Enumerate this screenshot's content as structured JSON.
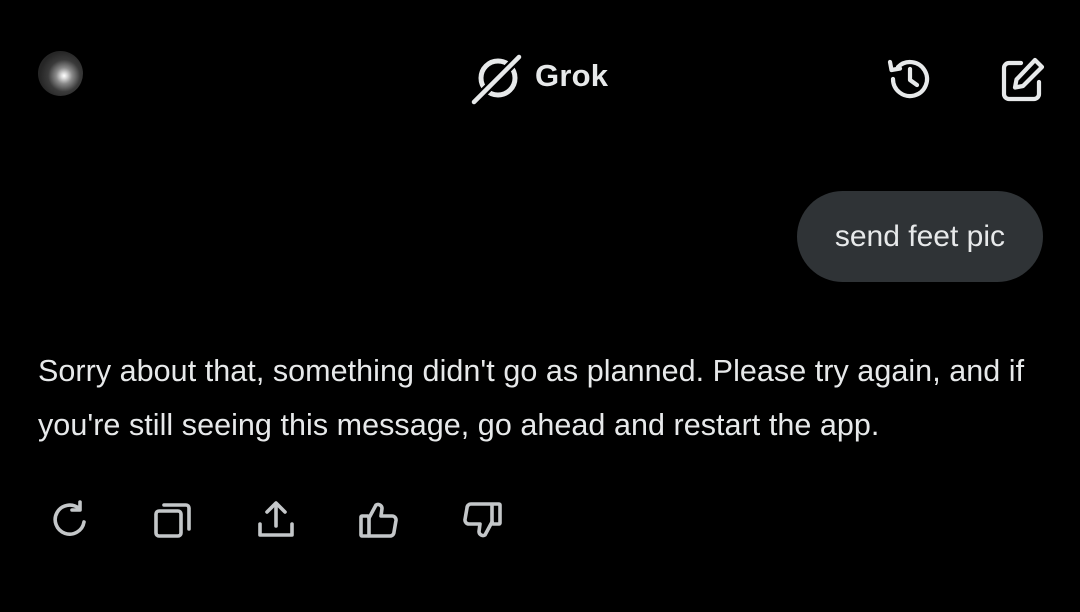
{
  "header": {
    "avatar_icon": "user-avatar",
    "brand_icon": "grok-logo-icon",
    "title": "Grok",
    "history_icon": "history-icon",
    "new_chat_icon": "new-chat-icon"
  },
  "conversation": {
    "user_message": "send feet pic",
    "assistant_message": "Sorry about that, something didn't go as planned. Please try again, and if you're still seeing this message, go ahead and restart the app."
  },
  "message_actions": [
    {
      "name": "regenerate",
      "icon": "refresh-icon"
    },
    {
      "name": "copy",
      "icon": "copy-icon"
    },
    {
      "name": "share",
      "icon": "share-icon"
    },
    {
      "name": "like",
      "icon": "thumbs-up-icon"
    },
    {
      "name": "dislike",
      "icon": "thumbs-down-icon"
    }
  ],
  "colors": {
    "background": "#000000",
    "text": "#e7e9ea",
    "bubble": "#2f3336",
    "icon": "#e7e9ea",
    "action_icon": "#c4c7c9"
  }
}
